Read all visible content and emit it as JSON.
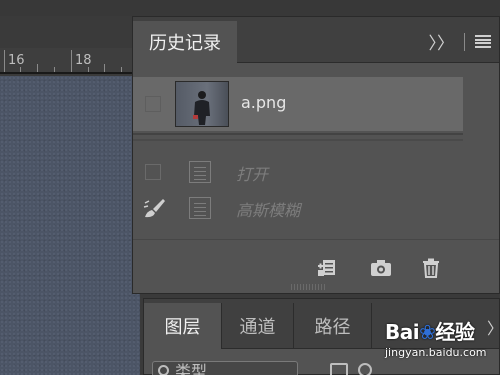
{
  "workspace": {
    "ruler": {
      "labels": [
        "16",
        "18"
      ]
    }
  },
  "history_panel": {
    "tab_label": "历史记录",
    "expand_glyph": "〉〉",
    "menu_icon": "hamburger-menu-icon",
    "snapshot": {
      "name": "a.png",
      "thumbnail": "photo-thumbnail"
    },
    "states": [
      {
        "label": "打开",
        "icon": "document-icon"
      },
      {
        "label": "高斯模糊",
        "icon": "document-icon",
        "brush": "history-brush-icon"
      }
    ],
    "footer_buttons": [
      "new-document-from-state-icon",
      "camera-snapshot-icon",
      "trash-icon"
    ]
  },
  "layers_panel": {
    "tabs": [
      "图层",
      "通道",
      "路径"
    ],
    "active_tab": "图层",
    "more_glyph": "〉",
    "filter_label": "类型"
  },
  "watermark": {
    "logo_text_1": "Bai",
    "logo_text_2": "经验",
    "url": "jingyan.baidu.com"
  },
  "colors": {
    "panel_bg": "#535353",
    "tabbar_bg": "#404040",
    "selected_row": "#696969",
    "canvas": "#4c5566",
    "baidu_blue": "#2f6fd6"
  }
}
